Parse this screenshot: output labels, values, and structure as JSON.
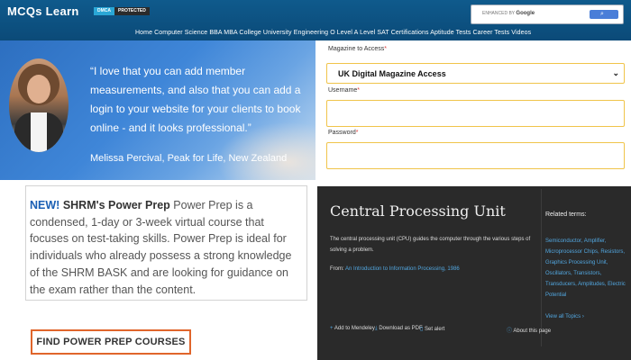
{
  "header": {
    "logo": "MCQs Learn",
    "badge_primary": "DMCA",
    "badge_secondary": "PROTECTED",
    "search": {
      "enhanced_by": "ENHANCED BY",
      "brand": "Google"
    },
    "nav": "Home Computer Science BBA MBA College University Engineering O Level A Level SAT Certifications Aptitude Tests Career Tests Videos"
  },
  "testimonial": {
    "quote": "“I love that you can add member measurements, and also that you can add a login to your website for your clients to book online - and it looks professional.”",
    "author": "Melissa Percival, Peak for Life, New Zealand"
  },
  "login_form": {
    "magazine_label": "Magazine to Access",
    "magazine_value": "UK Digital Magazine Access",
    "username_label": "Username",
    "password_label": "Password",
    "required_mark": "*"
  },
  "shrm": {
    "new_tag": "NEW!",
    "title": "SHRM's Power Prep",
    "body": "Power Prep is a condensed, 1-day or 3-week virtual course that focuses on test-taking skills. Power Prep is ideal for individuals who already possess a strong knowledge of the SHRM BASK and are looking for guidance on the exam rather than the content.",
    "button": "FIND POWER PREP COURSES"
  },
  "cpu": {
    "title": "Central Processing Unit",
    "definition": "The central processing unit (CPU) guides the computer through the various steps of solving a problem.",
    "source_prefix": "From:",
    "source_link": "An Introduction to Information Processing, 1986",
    "actions": {
      "mendeley": "Add to Mendeley",
      "pdf": "Download as PDF",
      "alert": "Set alert",
      "about": "About this page"
    },
    "related_heading": "Related terms:",
    "related_terms": "Semiconductor, Amplifier, Microprocessor Chips, Resistors, Graphics Processing Unit, Oscillators, Transistors, Transducers, Amplitudes, Electric Potential",
    "view_all": "View all Topics"
  },
  "colors": {
    "header_bg": "#0b4a78",
    "accent_yellow": "#f0c44a",
    "accent_orange": "#e0652b",
    "link_blue": "#52a7e0",
    "dark_panel": "#2a2a2a"
  }
}
